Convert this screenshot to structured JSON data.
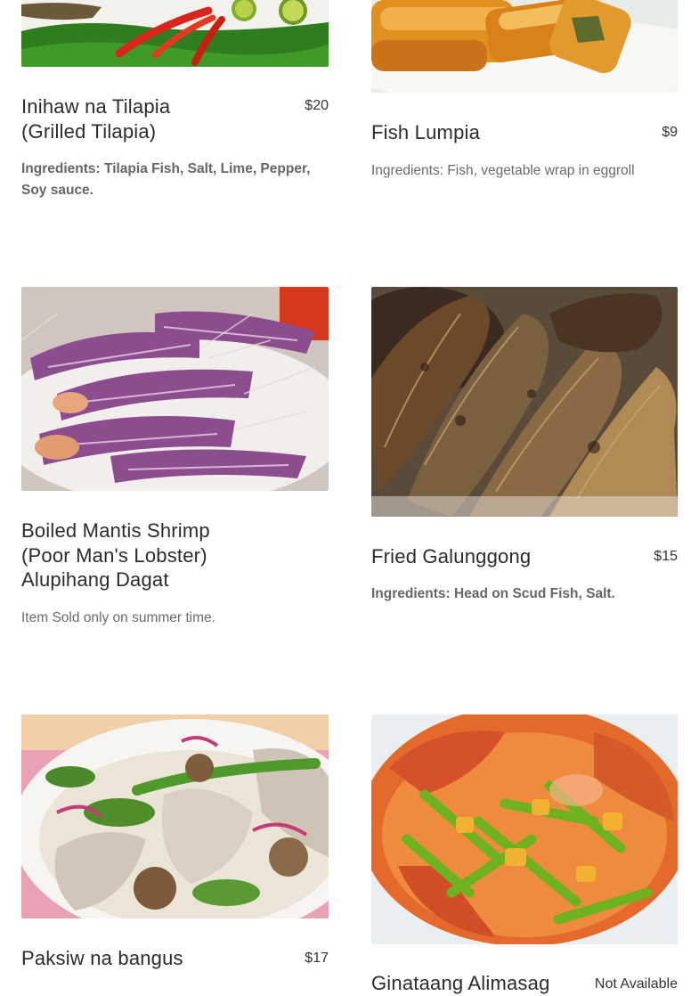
{
  "menu": {
    "items": [
      {
        "name": "Inihaw na Tilapia (Grilled Tilapia)",
        "price": "$20",
        "description": " Ingredients:  Tilapia Fish, Salt, Lime, Pepper, Soy sauce.",
        "photo_icon": "grilled-tilapia-photo"
      },
      {
        "name": "Fish Lumpia",
        "price": "$9",
        "description": "Ingredients: Fish, vegetable wrap in eggroll",
        "photo_icon": "fish-lumpia-photo"
      },
      {
        "name": "Boiled Mantis Shrimp (Poor Man's Lobster) Alupihang Dagat",
        "price": "",
        "description": "Item Sold only on summer time.",
        "photo_icon": "mantis-shrimp-photo"
      },
      {
        "name": "Fried Galunggong",
        "price": "$15",
        "description": " Ingredients:  Head on Scud Fish,  Salt.",
        "photo_icon": "fried-galunggong-photo"
      },
      {
        "name": "Paksiw na bangus",
        "price": "$17",
        "description": "",
        "photo_icon": "paksiw-na-bangus-photo"
      },
      {
        "name": "Ginataang Alimasag",
        "price": "Not Available",
        "description": "",
        "photo_icon": "ginataang-alimasag-photo"
      }
    ]
  }
}
